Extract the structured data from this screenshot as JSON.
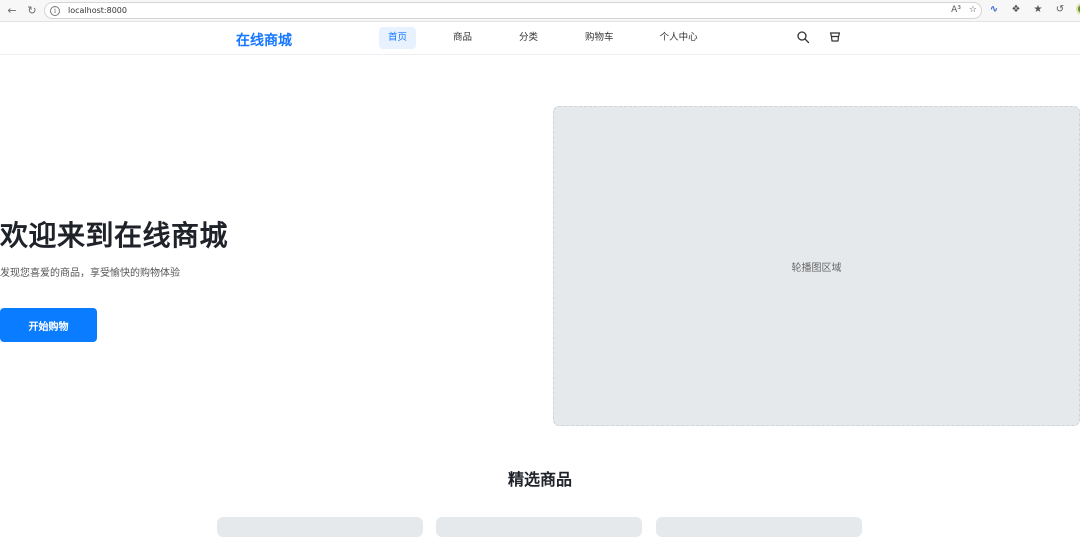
{
  "browser": {
    "url": "localhost:8000",
    "read_aloud_label": "A³"
  },
  "header": {
    "logo": "在线商城",
    "menu": [
      {
        "label": "首页",
        "active": true
      },
      {
        "label": "商品",
        "active": false
      },
      {
        "label": "分类",
        "active": false
      },
      {
        "label": "购物车",
        "active": false
      },
      {
        "label": "个人中心",
        "active": false
      }
    ],
    "accent_color": "#1677ff"
  },
  "hero": {
    "title": "欢迎来到在线商城",
    "subtitle": "发现您喜爱的商品，享受愉快的购物体验",
    "cta_label": "开始购物",
    "carousel_label": "轮播图区域"
  },
  "featured": {
    "title": "精选商品"
  },
  "icons": [
    "back-icon",
    "refresh-icon",
    "info-icon",
    "star-icon",
    "search-icon",
    "cart-icon"
  ]
}
